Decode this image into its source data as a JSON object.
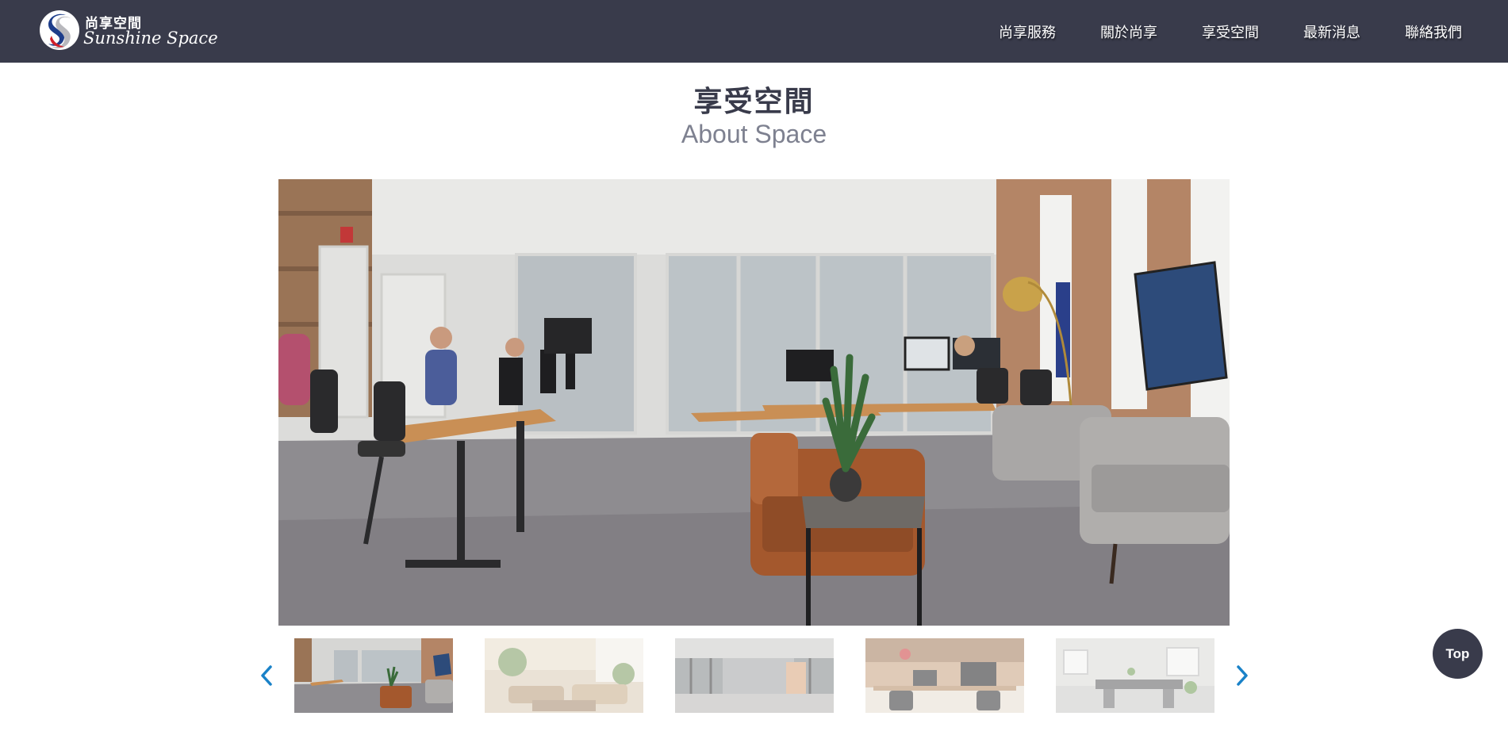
{
  "header": {
    "logo": {
      "name_cn": "尚享空間",
      "name_en": "Sunshine Space"
    },
    "nav": [
      {
        "label": "尚享服務"
      },
      {
        "label": "關於尚享"
      },
      {
        "label": "享受空間"
      },
      {
        "label": "最新消息"
      },
      {
        "label": "聯絡我們"
      }
    ]
  },
  "section": {
    "title_cn": "享受空間",
    "title_en": "About Space"
  },
  "gallery": {
    "main_image": "open-plan coworking office",
    "thumbnails": [
      {
        "image": "open-plan coworking office",
        "active": true
      },
      {
        "image": "lounge with plants and sofas",
        "active": false
      },
      {
        "image": "glass-walled corridor",
        "active": false
      },
      {
        "image": "office workstations with monitors",
        "active": false
      },
      {
        "image": "bright meeting room",
        "active": false
      }
    ],
    "prev_icon": "chevron-left-icon",
    "next_icon": "chevron-right-icon"
  },
  "top_button": {
    "label": "Top"
  },
  "colors": {
    "header_bg": "#393b4b",
    "accent": "#1a82c8",
    "subtitle": "#7e8190"
  }
}
